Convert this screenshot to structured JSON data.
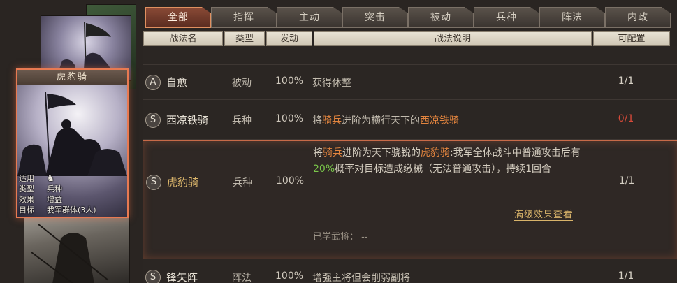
{
  "card": {
    "title": "虎豹骑",
    "info": [
      {
        "key": "适用",
        "value": ""
      },
      {
        "key": "类型",
        "value": "兵种"
      },
      {
        "key": "效果",
        "value": "增益"
      },
      {
        "key": "目标",
        "value": "我军群体(3人)"
      }
    ]
  },
  "tabs": [
    "全部",
    "指挥",
    "主动",
    "突击",
    "被动",
    "兵种",
    "阵法",
    "内政"
  ],
  "headers": {
    "name": "战法名",
    "type": "类型",
    "rate": "发动",
    "desc": "战法说明",
    "cfg": "可配置"
  },
  "rows": [
    {
      "grade": "A",
      "name": "自愈",
      "type": "被动",
      "rate": "100%",
      "desc": "获得休整",
      "cfg": "1/1"
    },
    {
      "grade": "S",
      "name": "西凉铁骑",
      "type": "兵种",
      "rate": "100%",
      "desc_parts": [
        "将",
        "骑兵",
        "进阶为横行天下的",
        "西凉铁骑"
      ],
      "cfg": "0/1"
    },
    {
      "grade": "S",
      "name": "虎豹骑",
      "type": "兵种",
      "rate": "100%",
      "desc_parts": [
        "将",
        "骑兵",
        "进阶为天下骁锐的",
        "虎豹骑",
        ":我军全体战斗中普通攻击后有",
        "20%",
        "概率对目标造成缴械（无法普通攻击），持续1回合"
      ],
      "cfg": "1/1",
      "more": "满级效果查看",
      "learned": "已学武将：  --"
    },
    {
      "grade": "S",
      "name": "锋矢阵",
      "type": "阵法",
      "rate": "100%",
      "desc": "增强主将但会削弱副将",
      "cfg": "1/1"
    }
  ],
  "colors": {
    "accent": "#e87a52",
    "highlight": "#e2843e",
    "percent": "#7ac64a",
    "unavailable": "#d84a3a"
  }
}
